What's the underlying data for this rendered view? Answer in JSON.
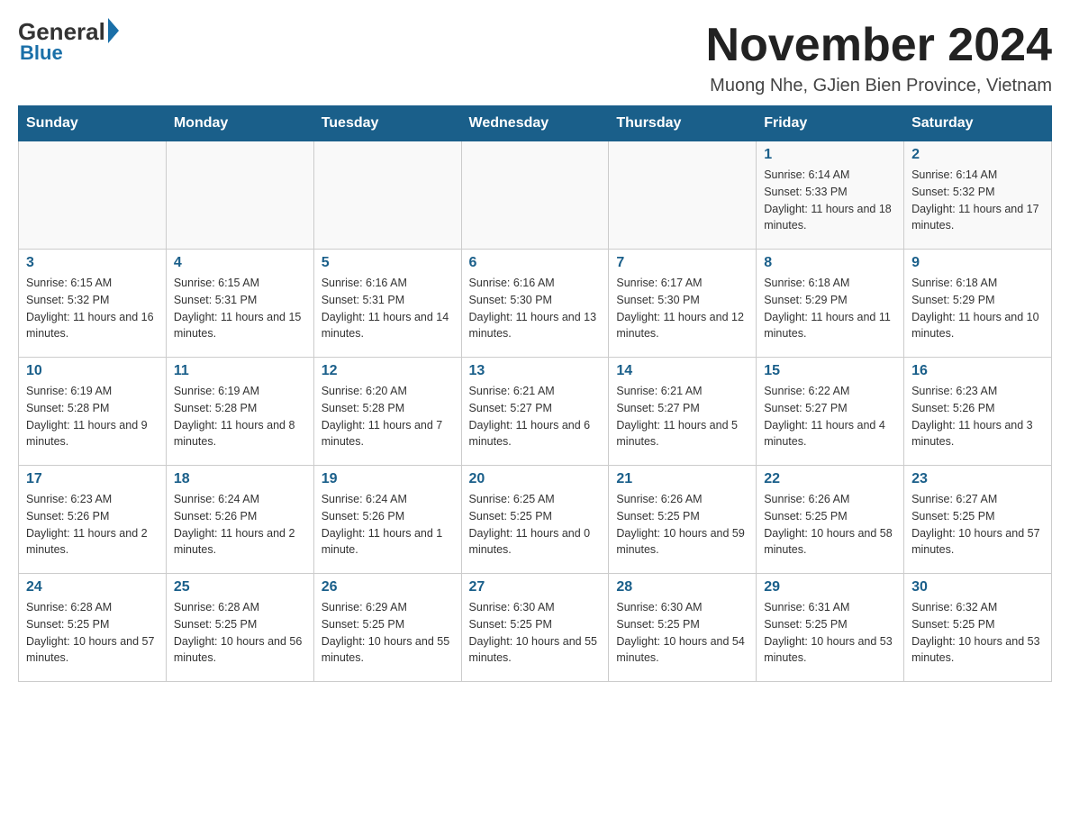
{
  "logo": {
    "general": "General",
    "triangle": "",
    "blue": "Blue"
  },
  "header": {
    "title": "November 2024",
    "subtitle": "Muong Nhe, GJien Bien Province, Vietnam"
  },
  "days_of_week": [
    "Sunday",
    "Monday",
    "Tuesday",
    "Wednesday",
    "Thursday",
    "Friday",
    "Saturday"
  ],
  "weeks": [
    [
      {
        "day": "",
        "info": ""
      },
      {
        "day": "",
        "info": ""
      },
      {
        "day": "",
        "info": ""
      },
      {
        "day": "",
        "info": ""
      },
      {
        "day": "",
        "info": ""
      },
      {
        "day": "1",
        "info": "Sunrise: 6:14 AM\nSunset: 5:33 PM\nDaylight: 11 hours and 18 minutes."
      },
      {
        "day": "2",
        "info": "Sunrise: 6:14 AM\nSunset: 5:32 PM\nDaylight: 11 hours and 17 minutes."
      }
    ],
    [
      {
        "day": "3",
        "info": "Sunrise: 6:15 AM\nSunset: 5:32 PM\nDaylight: 11 hours and 16 minutes."
      },
      {
        "day": "4",
        "info": "Sunrise: 6:15 AM\nSunset: 5:31 PM\nDaylight: 11 hours and 15 minutes."
      },
      {
        "day": "5",
        "info": "Sunrise: 6:16 AM\nSunset: 5:31 PM\nDaylight: 11 hours and 14 minutes."
      },
      {
        "day": "6",
        "info": "Sunrise: 6:16 AM\nSunset: 5:30 PM\nDaylight: 11 hours and 13 minutes."
      },
      {
        "day": "7",
        "info": "Sunrise: 6:17 AM\nSunset: 5:30 PM\nDaylight: 11 hours and 12 minutes."
      },
      {
        "day": "8",
        "info": "Sunrise: 6:18 AM\nSunset: 5:29 PM\nDaylight: 11 hours and 11 minutes."
      },
      {
        "day": "9",
        "info": "Sunrise: 6:18 AM\nSunset: 5:29 PM\nDaylight: 11 hours and 10 minutes."
      }
    ],
    [
      {
        "day": "10",
        "info": "Sunrise: 6:19 AM\nSunset: 5:28 PM\nDaylight: 11 hours and 9 minutes."
      },
      {
        "day": "11",
        "info": "Sunrise: 6:19 AM\nSunset: 5:28 PM\nDaylight: 11 hours and 8 minutes."
      },
      {
        "day": "12",
        "info": "Sunrise: 6:20 AM\nSunset: 5:28 PM\nDaylight: 11 hours and 7 minutes."
      },
      {
        "day": "13",
        "info": "Sunrise: 6:21 AM\nSunset: 5:27 PM\nDaylight: 11 hours and 6 minutes."
      },
      {
        "day": "14",
        "info": "Sunrise: 6:21 AM\nSunset: 5:27 PM\nDaylight: 11 hours and 5 minutes."
      },
      {
        "day": "15",
        "info": "Sunrise: 6:22 AM\nSunset: 5:27 PM\nDaylight: 11 hours and 4 minutes."
      },
      {
        "day": "16",
        "info": "Sunrise: 6:23 AM\nSunset: 5:26 PM\nDaylight: 11 hours and 3 minutes."
      }
    ],
    [
      {
        "day": "17",
        "info": "Sunrise: 6:23 AM\nSunset: 5:26 PM\nDaylight: 11 hours and 2 minutes."
      },
      {
        "day": "18",
        "info": "Sunrise: 6:24 AM\nSunset: 5:26 PM\nDaylight: 11 hours and 2 minutes."
      },
      {
        "day": "19",
        "info": "Sunrise: 6:24 AM\nSunset: 5:26 PM\nDaylight: 11 hours and 1 minute."
      },
      {
        "day": "20",
        "info": "Sunrise: 6:25 AM\nSunset: 5:25 PM\nDaylight: 11 hours and 0 minutes."
      },
      {
        "day": "21",
        "info": "Sunrise: 6:26 AM\nSunset: 5:25 PM\nDaylight: 10 hours and 59 minutes."
      },
      {
        "day": "22",
        "info": "Sunrise: 6:26 AM\nSunset: 5:25 PM\nDaylight: 10 hours and 58 minutes."
      },
      {
        "day": "23",
        "info": "Sunrise: 6:27 AM\nSunset: 5:25 PM\nDaylight: 10 hours and 57 minutes."
      }
    ],
    [
      {
        "day": "24",
        "info": "Sunrise: 6:28 AM\nSunset: 5:25 PM\nDaylight: 10 hours and 57 minutes."
      },
      {
        "day": "25",
        "info": "Sunrise: 6:28 AM\nSunset: 5:25 PM\nDaylight: 10 hours and 56 minutes."
      },
      {
        "day": "26",
        "info": "Sunrise: 6:29 AM\nSunset: 5:25 PM\nDaylight: 10 hours and 55 minutes."
      },
      {
        "day": "27",
        "info": "Sunrise: 6:30 AM\nSunset: 5:25 PM\nDaylight: 10 hours and 55 minutes."
      },
      {
        "day": "28",
        "info": "Sunrise: 6:30 AM\nSunset: 5:25 PM\nDaylight: 10 hours and 54 minutes."
      },
      {
        "day": "29",
        "info": "Sunrise: 6:31 AM\nSunset: 5:25 PM\nDaylight: 10 hours and 53 minutes."
      },
      {
        "day": "30",
        "info": "Sunrise: 6:32 AM\nSunset: 5:25 PM\nDaylight: 10 hours and 53 minutes."
      }
    ]
  ]
}
